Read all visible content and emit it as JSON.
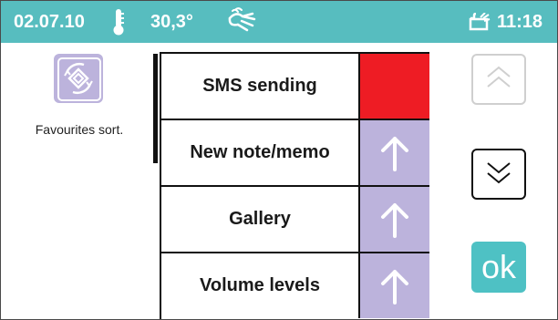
{
  "status_bar": {
    "date": "02.07.10",
    "temperature": "30,3°",
    "time": "11:18",
    "background": "#57bdbf",
    "icons": [
      "thermometer-icon",
      "hand-wave-icon",
      "message-icon"
    ]
  },
  "favourites": {
    "label": "Favourites sort.",
    "icon": "favourites-sort-icon",
    "tile_color": "#bcb3dc"
  },
  "list": {
    "items": [
      {
        "label": "SMS sending",
        "action": "selected",
        "action_color": "#ee1c24"
      },
      {
        "label": "New note/memo",
        "action": "move-up-icon",
        "action_color": "#bcb3dc"
      },
      {
        "label": "Gallery",
        "action": "move-up-icon",
        "action_color": "#bcb3dc"
      },
      {
        "label": "Volume levels",
        "action": "move-up-icon",
        "action_color": "#bcb3dc"
      }
    ]
  },
  "navigation": {
    "up_icon": "double-chevron-up-icon",
    "down_icon": "double-chevron-down-icon",
    "ok_label": "ok",
    "ok_color": "#4ec1c4"
  }
}
